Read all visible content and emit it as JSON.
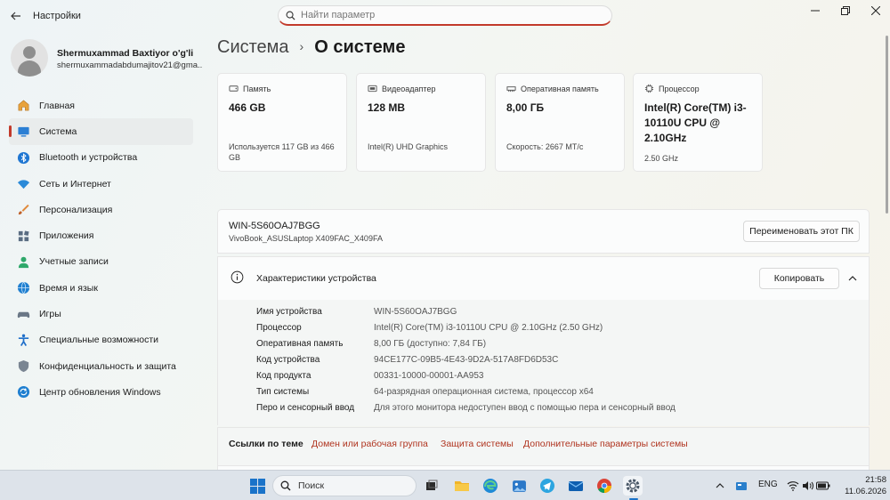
{
  "window": {
    "title": "Настройки",
    "search_placeholder": "Найти параметр"
  },
  "profile": {
    "name": "Shermuxammad Baxtiyor o'g'li",
    "email": "shermuxammadabdumajitov21@gma..."
  },
  "nav": {
    "items": [
      {
        "label": "Главная",
        "icon": "home-icon"
      },
      {
        "label": "Система",
        "icon": "system-icon"
      },
      {
        "label": "Bluetooth и устройства",
        "icon": "bluetooth-icon"
      },
      {
        "label": "Сеть и Интернет",
        "icon": "wifi-icon"
      },
      {
        "label": "Персонализация",
        "icon": "brush-icon"
      },
      {
        "label": "Приложения",
        "icon": "apps-icon"
      },
      {
        "label": "Учетные записи",
        "icon": "accounts-icon"
      },
      {
        "label": "Время и язык",
        "icon": "globe-icon"
      },
      {
        "label": "Игры",
        "icon": "gamepad-icon"
      },
      {
        "label": "Специальные возможности",
        "icon": "accessibility-icon"
      },
      {
        "label": "Конфиденциальность и защита",
        "icon": "shield-icon"
      },
      {
        "label": "Центр обновления Windows",
        "icon": "update-icon"
      }
    ],
    "active_index": 1
  },
  "breadcrumb": {
    "parent": "Система",
    "separator": "›",
    "current": "О системе"
  },
  "cards": [
    {
      "title": "Память",
      "value": "466 GB",
      "sub": "Используется 117 GB из 466 GB",
      "icon": "storage-icon"
    },
    {
      "title": "Видеоадаптер",
      "value": "128 MB",
      "sub": "Intel(R) UHD Graphics",
      "icon": "gpu-icon"
    },
    {
      "title": "Оперативная память",
      "value": "8,00 ГБ",
      "sub": "Скорость: 2667 МТ/с",
      "icon": "ram-icon"
    },
    {
      "title": "Процессор",
      "value": "Intel(R) Core(TM) i3-10110U CPU @ 2.10GHz",
      "sub": "2.50 GHz",
      "icon": "cpu-icon"
    }
  ],
  "pc": {
    "name": "WIN-5S60OAJ7BGG",
    "model": "VivoBook_ASUSLaptop X409FAC_X409FA",
    "rename_label": "Переименовать этот ПК"
  },
  "specs": {
    "title": "Характеристики устройства",
    "copy_label": "Копировать",
    "rows": [
      {
        "key": "Имя устройства",
        "value": "WIN-5S60OAJ7BGG"
      },
      {
        "key": "Процессор",
        "value": "Intel(R) Core(TM) i3-10110U CPU @ 2.10GHz (2.50 GHz)"
      },
      {
        "key": "Оперативная память",
        "value": "8,00 ГБ (доступно: 7,84 ГБ)"
      },
      {
        "key": "Код устройства",
        "value": "94CE177C-09B5-4E43-9D2A-517A8FD6D53C"
      },
      {
        "key": "Код продукта",
        "value": "00331-10000-00001-AA953"
      },
      {
        "key": "Тип системы",
        "value": "64-разрядная операционная система, процессор x64"
      },
      {
        "key": "Перо и сенсорный ввод",
        "value": "Для этого монитора недоступен ввод с помощью пера и сенсорный ввод"
      }
    ]
  },
  "related_links": {
    "label": "Ссылки по теме",
    "links": [
      "Домен или рабочая группа",
      "Защита системы",
      "Дополнительные параметры системы"
    ]
  },
  "taskbar": {
    "search_label": "Поиск",
    "language": "ENG",
    "time": "21:58",
    "date": "11.06.2026"
  },
  "colors": {
    "accent": "#c23a2b",
    "link": "#b0341f",
    "taskbar": "#dde3ea"
  }
}
